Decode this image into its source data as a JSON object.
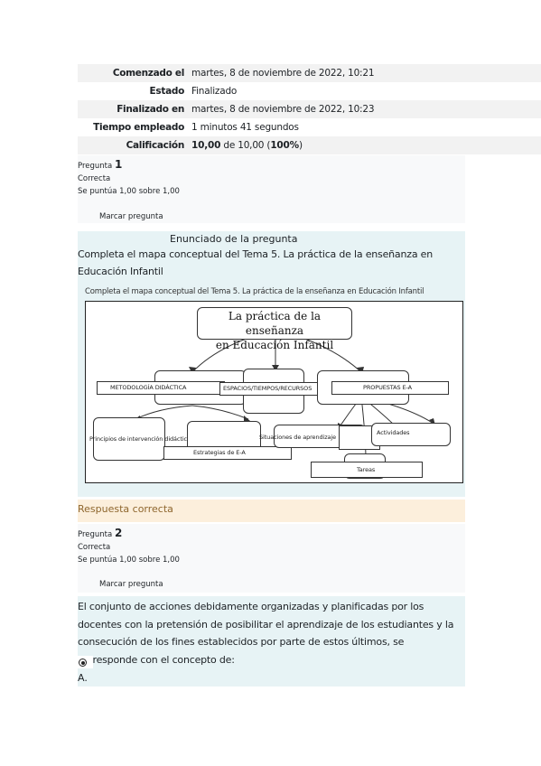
{
  "summary": [
    {
      "key": "Comenzado el",
      "value": "martes, 8 de noviembre de 2022, 10:21"
    },
    {
      "key": "Estado",
      "value": "Finalizado"
    },
    {
      "key": "Finalizado en",
      "value": "martes, 8 de noviembre de 2022, 10:23"
    },
    {
      "key": "Tiempo empleado",
      "value": "1 minutos 41 segundos"
    },
    {
      "key": "Calificación",
      "grade": "10,00",
      "of": " de 10,00 (",
      "percent": "100%",
      "close": ")"
    }
  ],
  "q1": {
    "label": "Pregunta ",
    "number": "1",
    "status": "Correcta",
    "score": "Se puntúa 1,00 sobre 1,00",
    "flag": "Marcar pregunta",
    "heading": "Enunciado de la pregunta",
    "text": "Completa el mapa conceptual del Tema 5. La práctica de la enseñanza en Educación Infantil",
    "diagram": {
      "caption": "Completa el mapa conceptual del Tema 5. La práctica de la enseñanza en Educación Infantil",
      "title_line1": "La práctica de la enseñanza",
      "title_line2": "en Educación Infantil",
      "node_metodologia": "METODOLOGÍA DIDÁCTICA",
      "node_espacios": "ESPACIOS/TIEMPOS/RECURSOS",
      "node_propuestas": "PROPUESTAS E-A",
      "node_principios": "Principios de intervención didáctica",
      "node_estrategias": "Estrategias de E-A",
      "node_situaciones": "Situaciones de aprendizaje",
      "node_actividades": "Actividades",
      "node_tareas": "Tareas"
    },
    "feedback": "Respuesta correcta"
  },
  "q2": {
    "label": "Pregunta ",
    "number": "2",
    "status": "Correcta",
    "score": "Se puntúa 1,00 sobre 1,00",
    "flag": "Marcar pregunta",
    "text": "El conjunto de acciones debidamente organizadas y planificadas por los docentes con la pretensión de posibilitar el aprendizaje de los estudiantes y la consecución de los fines establecidos por parte de estos últimos, se corresponde con el concepto de:",
    "option_letter": "A."
  }
}
